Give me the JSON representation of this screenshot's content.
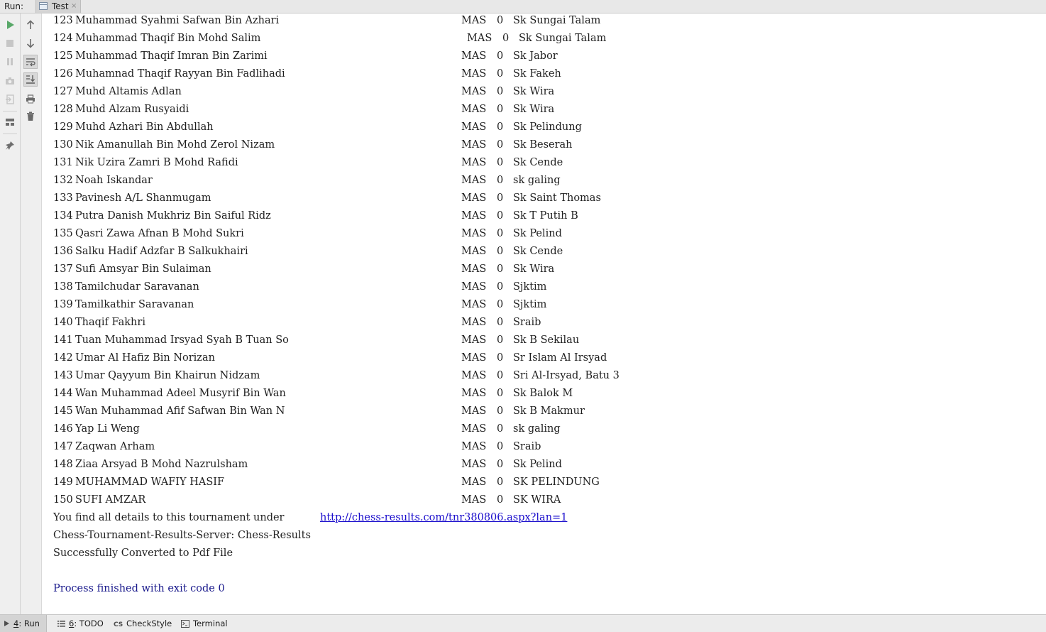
{
  "header": {
    "run_label": "Run:",
    "tab_label": "Test",
    "tab_close": "×"
  },
  "gutter_left": [
    {
      "name": "rerun-icon",
      "color": "#59a869"
    },
    {
      "name": "stop-icon",
      "color": "#c9c9c9"
    },
    {
      "name": "pause-icon",
      "color": "#c9c9c9"
    },
    {
      "name": "dump-threads-icon",
      "color": "#c9c9c9"
    },
    {
      "name": "exit-icon",
      "color": "#c9c9c9"
    },
    {
      "name": "layout-icon",
      "color": "#6e6e6e"
    },
    {
      "name": "pin-icon",
      "color": "#6e6e6e"
    }
  ],
  "gutter_right": [
    {
      "name": "up-arrow-icon"
    },
    {
      "name": "down-arrow-icon"
    },
    {
      "name": "soft-wrap-icon"
    },
    {
      "name": "scroll-to-end-icon"
    },
    {
      "name": "print-icon"
    },
    {
      "name": "trash-icon"
    }
  ],
  "console": {
    "rows": [
      {
        "num": "123",
        "name": "Muhammad Syahmi Safwan Bin Azhari",
        "fed": "MAS",
        "rating": "0",
        "club": "Sk Sungai Talam"
      },
      {
        "num": "124",
        "name": "Muhammad Thaqif Bin Mohd Salim",
        "fed": "MAS",
        "rating": "0",
        "club": "Sk Sungai Talam",
        "shift": true
      },
      {
        "num": "125",
        "name": "Muhammad Thaqif Imran Bin Zarimi",
        "fed": "MAS",
        "rating": "0",
        "club": "Sk Jabor"
      },
      {
        "num": "126",
        "name": "Muhamnad Thaqif Rayyan Bin Fadlihadi",
        "fed": "MAS",
        "rating": "0",
        "club": "Sk Fakeh"
      },
      {
        "num": "127",
        "name": "Muhd Altamis Adlan",
        "fed": "MAS",
        "rating": "0",
        "club": "Sk Wira"
      },
      {
        "num": "128",
        "name": "Muhd Alzam Rusyaidi",
        "fed": "MAS",
        "rating": "0",
        "club": "Sk Wira"
      },
      {
        "num": "129",
        "name": "Muhd Azhari Bin Abdullah",
        "fed": "MAS",
        "rating": "0",
        "club": "Sk Pelindung"
      },
      {
        "num": "130",
        "name": "Nik Amanullah Bin Mohd Zerol Nizam",
        "fed": "MAS",
        "rating": "0",
        "club": "Sk Beserah"
      },
      {
        "num": "131",
        "name": "Nik Uzira Zamri B Mohd Rafidi",
        "fed": "MAS",
        "rating": "0",
        "club": "Sk Cende"
      },
      {
        "num": "132",
        "name": "Noah Iskandar",
        "fed": "MAS",
        "rating": "0",
        "club": "sk galing"
      },
      {
        "num": "133",
        "name": "Pavinesh A/L Shanmugam",
        "fed": "MAS",
        "rating": "0",
        "club": "Sk Saint Thomas"
      },
      {
        "num": "134",
        "name": "Putra Danish Mukhriz Bin Saiful Ridz",
        "fed": "MAS",
        "rating": "0",
        "club": "Sk T Putih B"
      },
      {
        "num": "135",
        "name": "Qasri Zawa Afnan B Mohd Sukri",
        "fed": "MAS",
        "rating": "0",
        "club": "Sk Pelind"
      },
      {
        "num": "136",
        "name": "Salku Hadif Adzfar B Salkukhairi",
        "fed": "MAS",
        "rating": "0",
        "club": "Sk Cende"
      },
      {
        "num": "137",
        "name": "Sufi Amsyar Bin Sulaiman",
        "fed": "MAS",
        "rating": "0",
        "club": "Sk Wira"
      },
      {
        "num": "138",
        "name": "Tamilchudar Saravanan",
        "fed": "MAS",
        "rating": "0",
        "club": "Sjktim"
      },
      {
        "num": "139",
        "name": "Tamilkathir Saravanan",
        "fed": "MAS",
        "rating": "0",
        "club": "Sjktim"
      },
      {
        "num": "140",
        "name": "Thaqif Fakhri",
        "fed": "MAS",
        "rating": "0",
        "club": "Sraib"
      },
      {
        "num": "141",
        "name": "Tuan Muhammad Irsyad Syah B Tuan So",
        "fed": "MAS",
        "rating": "0",
        "club": "Sk B Sekilau"
      },
      {
        "num": "142",
        "name": "Umar Al Hafiz Bin Norizan",
        "fed": "MAS",
        "rating": "0",
        "club": "Sr Islam Al Irsyad"
      },
      {
        "num": "143",
        "name": "Umar Qayyum Bin Khairun Nidzam",
        "fed": "MAS",
        "rating": "0",
        "club": "Sri Al-Irsyad, Batu 3"
      },
      {
        "num": "144",
        "name": "Wan Muhammad Adeel Musyrif Bin Wan",
        "fed": "MAS",
        "rating": "0",
        "club": "Sk Balok M"
      },
      {
        "num": "145",
        "name": "Wan Muhammad Afif Safwan Bin Wan N",
        "fed": "MAS",
        "rating": "0",
        "club": "Sk B Makmur"
      },
      {
        "num": "146",
        "name": "Yap Li Weng",
        "fed": "MAS",
        "rating": "0",
        "club": "sk galing"
      },
      {
        "num": "147",
        "name": "Zaqwan Arham",
        "fed": "MAS",
        "rating": "0",
        "club": "Sraib"
      },
      {
        "num": "148",
        "name": "Ziaa Arsyad B Mohd Nazrulsham",
        "fed": "MAS",
        "rating": "0",
        "club": "Sk Pelind"
      },
      {
        "num": "149",
        "name": "MUHAMMAD WAFIY HASIF",
        "fed": "MAS",
        "rating": "0",
        "club": "SK PELINDUNG"
      },
      {
        "num": "150",
        "name": "SUFI AMZAR",
        "fed": "MAS",
        "rating": "0",
        "club": "SK WIRA"
      }
    ],
    "details_text": "You find all details to this tournament under",
    "details_link": "http://chess-results.com/tnr380806.aspx?lan=1",
    "server_line": "Chess-Tournament-Results-Server: Chess-Results",
    "converted_line": "Successfully Converted to Pdf File",
    "exit_line": "Process finished with exit code 0",
    "link_color": "#1a0dcc",
    "exit_color": "#1a1a8c"
  },
  "bottom_tabs": [
    {
      "label": "4: Run",
      "shortcut": "4",
      "rest": ": Run",
      "icon": "run-tab-icon",
      "active": true
    },
    {
      "label": "6: TODO",
      "shortcut": "6",
      "rest": ": TODO",
      "icon": "todo-list-icon",
      "active": false
    },
    {
      "label": "CheckStyle",
      "icon": "checkstyle-icon",
      "active": false
    },
    {
      "label": "Terminal",
      "icon": "terminal-icon",
      "active": false
    }
  ]
}
